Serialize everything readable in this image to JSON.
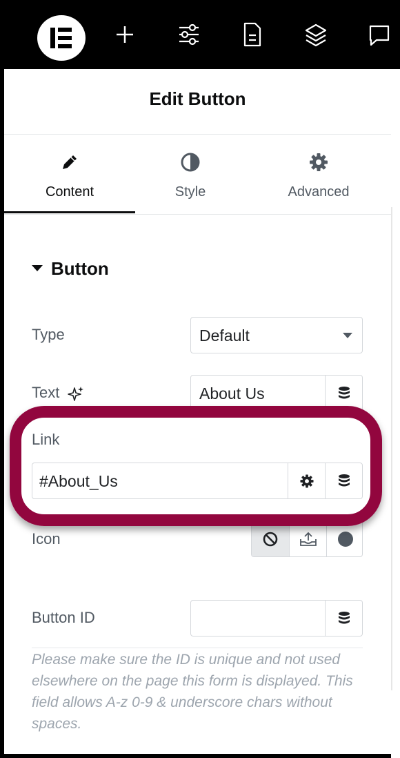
{
  "topbar": {
    "icons": [
      "elementor-logo-icon",
      "add-icon",
      "settings-sliders-icon",
      "page-icon",
      "layers-icon",
      "comment-icon"
    ],
    "bg": "#000000"
  },
  "panel": {
    "title": "Edit Button",
    "tabs": [
      {
        "label": "Content",
        "icon": "pencil-icon",
        "active": true
      },
      {
        "label": "Style",
        "icon": "half-circle-icon",
        "active": false
      },
      {
        "label": "Advanced",
        "icon": "gear-icon",
        "active": false
      }
    ]
  },
  "section": {
    "title": "Button",
    "fields": {
      "type": {
        "label": "Type",
        "value": "Default"
      },
      "text": {
        "label": "Text",
        "value": "About Us",
        "ai_icon": "sparkle-icon"
      },
      "link": {
        "label": "Link",
        "value": "#About_Us"
      },
      "icon": {
        "label": "Icon",
        "options": [
          "none-icon",
          "upload-icon",
          "circle-icon"
        ],
        "selected": "none-icon"
      },
      "button_id": {
        "label": "Button ID",
        "value": ""
      }
    },
    "help_text": "Please make sure the ID is unique and not used elsewhere on the page this form is displayed. This field allows A-z  0-9 & underscore chars without spaces."
  },
  "colors": {
    "highlight": "#92063e",
    "text": "#1f2124",
    "muted": "#515962",
    "border": "#d5d8dc"
  }
}
